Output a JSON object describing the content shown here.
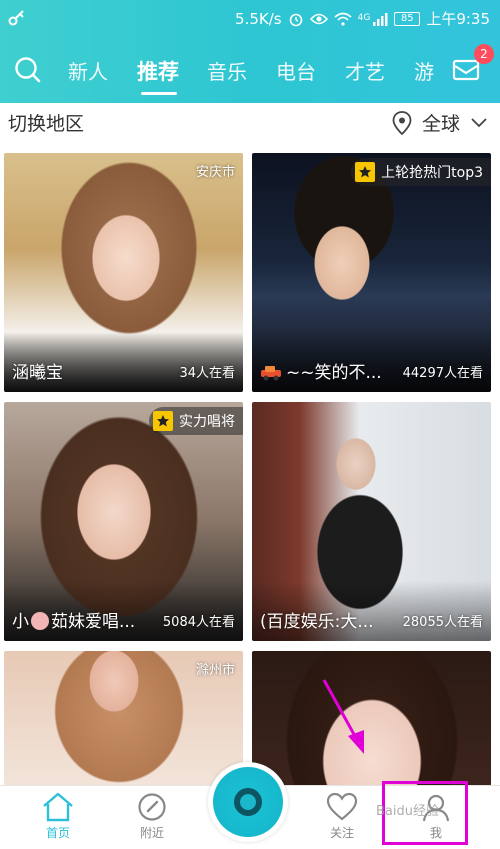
{
  "status_bar": {
    "network_speed": "5.5K/s",
    "network_type": "4G",
    "battery": "85",
    "time": "上午9:35"
  },
  "top_nav": {
    "tabs": [
      "新人",
      "推荐",
      "音乐",
      "电台",
      "才艺",
      "游"
    ],
    "active_tab": "推荐",
    "mail_badge": "2"
  },
  "region": {
    "title": "切换地区",
    "value": "全球"
  },
  "cards": [
    {
      "name": "涵曦宝",
      "viewers": "34人在看",
      "city": "安庆市",
      "tag": ""
    },
    {
      "name": "~~笑的不...",
      "viewers": "44297人在看",
      "city": "",
      "tag": "上轮抢热门top3"
    },
    {
      "name": "茹妹爱唱...",
      "name_prefix": "小",
      "viewers": "5084人在看",
      "city": "",
      "tag": "实力唱将"
    },
    {
      "name": "(百度娱乐:大...",
      "viewers": "28055人在看",
      "city": "",
      "tag": ""
    },
    {
      "name": "",
      "viewers": "",
      "city": "滁州市",
      "tag": ""
    },
    {
      "name": "",
      "viewers": "",
      "city": "",
      "tag": ""
    }
  ],
  "bottom_nav": {
    "home": "首页",
    "nearby": "附近",
    "follow": "关注",
    "me": "我"
  },
  "watermark": "Baidu经验",
  "colors": {
    "accent": "#2ec6d2",
    "badge": "#ff4d5e",
    "highlight": "#e000d8",
    "star": "#f7c600"
  }
}
